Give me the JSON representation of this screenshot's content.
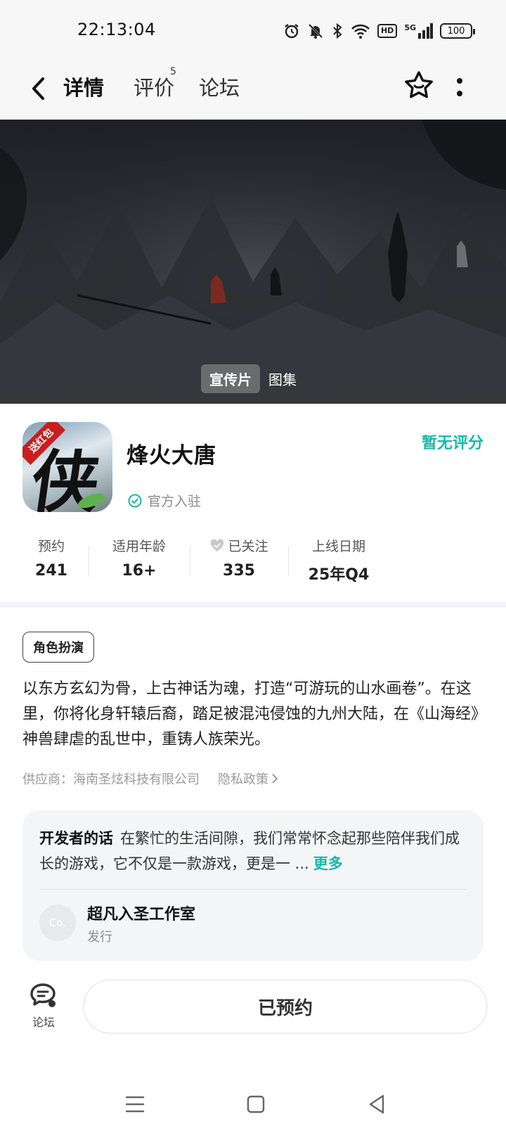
{
  "status_bar": {
    "time": "22:13:04",
    "battery": "100",
    "network": "5G",
    "hd": "HD",
    "icons": [
      "alarm-icon",
      "mute-icon",
      "bluetooth-icon",
      "wifi-icon",
      "hd-icon",
      "signal-icon",
      "battery-icon"
    ]
  },
  "nav": {
    "tabs": [
      {
        "label": "详情",
        "active": true
      },
      {
        "label": "评价",
        "badge": "5"
      },
      {
        "label": "论坛"
      }
    ]
  },
  "banner": {
    "tabs": [
      {
        "label": "宣传片",
        "active": true
      },
      {
        "label": "图集"
      }
    ]
  },
  "game": {
    "title": "烽火大唐",
    "rating_text": "暂无评分",
    "verified_text": "官方入驻",
    "icon_ribbon": "送红包",
    "icon_glyph": "侠"
  },
  "stats": [
    {
      "label": "预约",
      "value": "241"
    },
    {
      "label": "适用年龄",
      "value": "16+"
    },
    {
      "label": "已关注",
      "value": "335"
    },
    {
      "label": "上线日期",
      "value": "25年Q4"
    }
  ],
  "genre_tag": "角色扮演",
  "description": "以东方玄幻为骨，上古神话为魂，打造“可游玩的山水画卷”。在这里，你将化身轩辕后裔，踏足被混沌侵蚀的九州大陆，在《山海经》神兽肆虐的乱世中，重铸人族荣光。",
  "supplier": "供应商：海南圣炫科技有限公司",
  "privacy_link": "隐私政策",
  "developer": {
    "label": "开发者的话",
    "text": "在繁忙的生活间隙，我们常常怀念起那些陪伴我们成长的游戏，它不仅是一款游戏，更是一 ...",
    "more": "更多",
    "studio_avatar": "Co.",
    "studio_name": "超凡入圣工作室",
    "studio_role": "发行"
  },
  "bottom": {
    "forum_label": "论坛",
    "reserve_label": "已预约"
  },
  "colors": {
    "accent": "#19b8a8",
    "tab_underline": "#19c9b8"
  }
}
